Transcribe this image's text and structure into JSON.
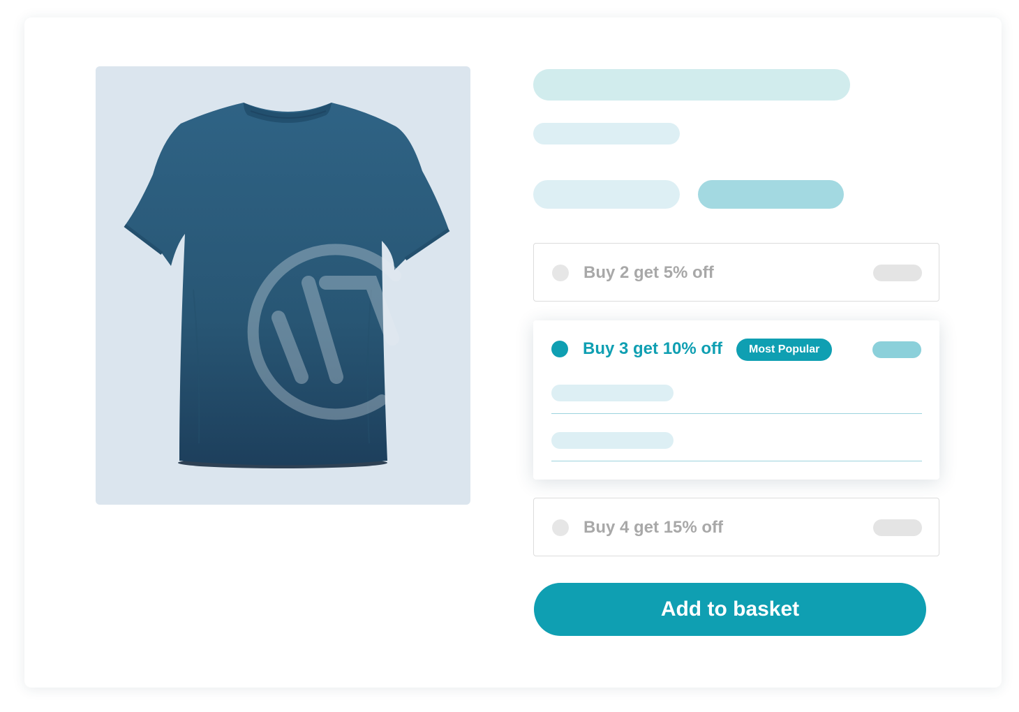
{
  "product": {
    "image_icon": "tshirt-product-image",
    "watermark_icon": "brand-logo-watermark"
  },
  "offers": [
    {
      "label": "Buy 2 get 5% off",
      "selected": false
    },
    {
      "label": "Buy 3 get 10% off",
      "selected": true,
      "badge": "Most Popular"
    },
    {
      "label": "Buy 4 get 15% off",
      "selected": false
    }
  ],
  "actions": {
    "add_to_basket": "Add to basket"
  },
  "colors": {
    "accent": "#0f9fb2",
    "placeholder_light": "#ddeff4",
    "placeholder_mid": "#cdebef",
    "placeholder_strong": "#a3d9e1",
    "inactive_text": "#a8a8a8",
    "inactive_dot": "#e6e6e6",
    "image_background": "#dbe5ee",
    "shirt": "#2b5b7c"
  }
}
